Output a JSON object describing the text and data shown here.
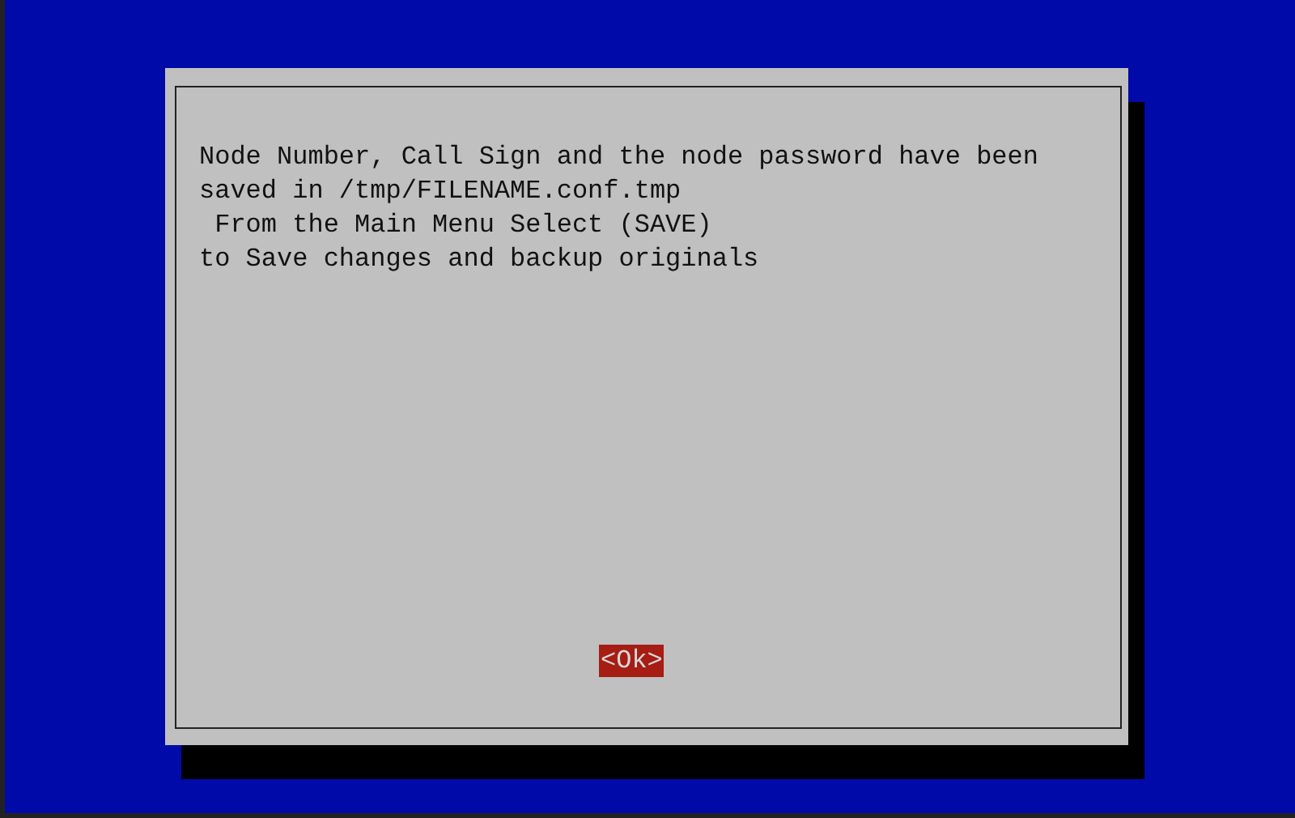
{
  "dialog": {
    "message_lines": [
      "Node Number, Call Sign and the node password have been",
      "saved in /tmp/FILENAME.conf.tmp",
      " From the Main Menu Select (SAVE)",
      "to Save changes and backup originals"
    ],
    "buttons": [
      {
        "label": "<Ok>",
        "selected": true
      }
    ]
  }
}
